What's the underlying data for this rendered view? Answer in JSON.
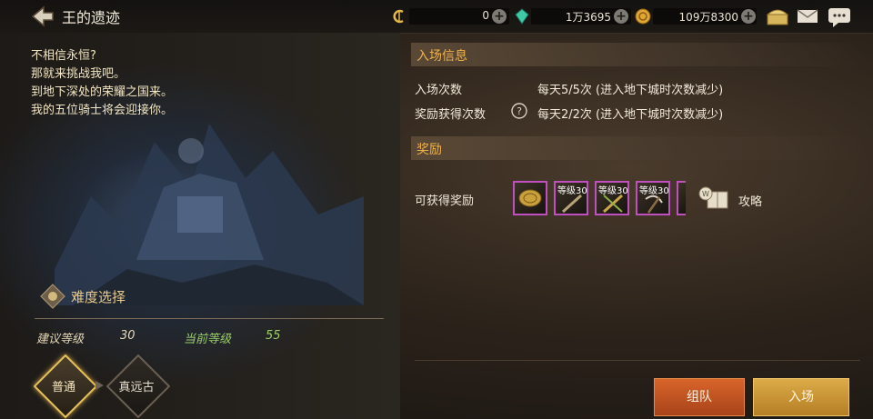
{
  "header": {
    "title": "王的遗迹",
    "currency": [
      {
        "icon": "c-currency-icon",
        "value": "0"
      },
      {
        "icon": "gem-icon",
        "value": "1万3695"
      },
      {
        "icon": "gold-coin-icon",
        "value": "109万8300"
      }
    ],
    "right_icons": [
      "treasure-chest-icon",
      "mail-icon",
      "chat-icon"
    ]
  },
  "description": [
    "不相信永恒?",
    "那就来挑战我吧。",
    "到地下深处的荣耀之国来。",
    "我的五位骑士将会迎接你。"
  ],
  "difficulty": {
    "title": "难度选择",
    "recommended_label": "建议等级",
    "recommended_value": "30",
    "current_label": "当前等级",
    "current_value": "55",
    "options": [
      "普通",
      "真远古"
    ]
  },
  "entry_info": {
    "header": "入场信息",
    "rows": [
      {
        "label": "入场次数",
        "value": "每天5/5次 (进入地下城时次数减少)"
      },
      {
        "label": "奖励获得次数",
        "value": "每天2/2次 (进入地下城时次数减少)"
      }
    ]
  },
  "rewards": {
    "header": "奖励",
    "label": "可获得奖励",
    "items": [
      {
        "level": ""
      },
      {
        "level": "等级30"
      },
      {
        "level": "等级30"
      },
      {
        "level": "等级30"
      }
    ],
    "guide_label": "攻略"
  },
  "actions": {
    "party": "组队",
    "enter": "入场"
  },
  "colors": {
    "accent": "#f0b14a",
    "party_button": "#c1541f",
    "enter_button": "#c89436",
    "current_level": "#9ccf6a"
  }
}
